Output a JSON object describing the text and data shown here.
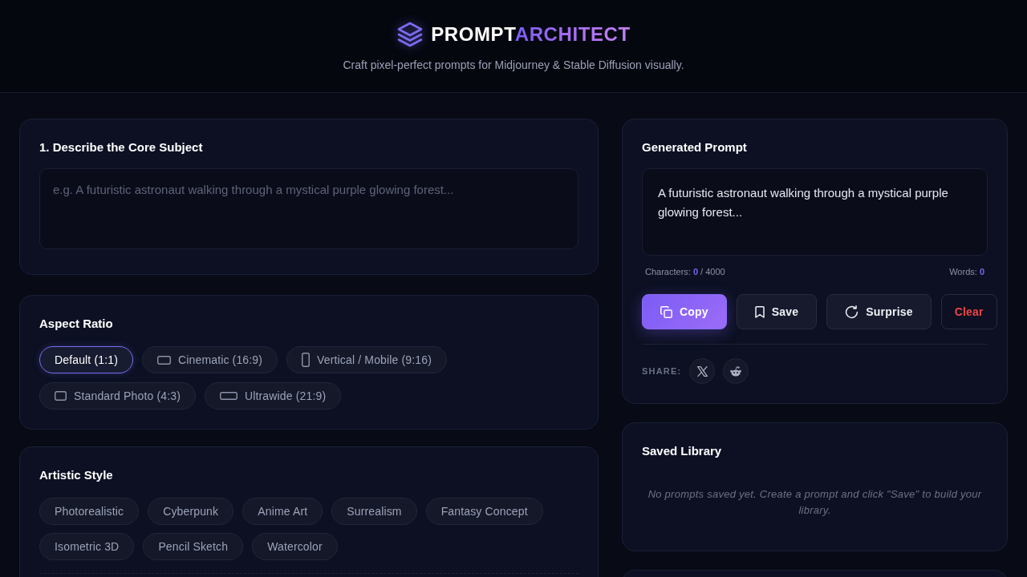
{
  "header": {
    "logo": {
      "text_main": "PROMPT",
      "text_accent": "ARCHITECT"
    },
    "tagline": "Craft pixel-perfect prompts for Midjourney & Stable Diffusion visually."
  },
  "subject": {
    "title": "1. Describe the Core Subject",
    "placeholder": "e.g. A futuristic astronaut walking through a mystical purple glowing forest..."
  },
  "aspect_ratio": {
    "title": "Aspect Ratio",
    "options": [
      {
        "label": "Default (1:1)",
        "kind": "plain",
        "selected": true
      },
      {
        "label": "Cinematic (16:9)",
        "kind": "wide",
        "selected": false
      },
      {
        "label": "Vertical / Mobile (9:16)",
        "kind": "tall",
        "selected": false
      },
      {
        "label": "Standard Photo (4:3)",
        "kind": "photo",
        "selected": false
      },
      {
        "label": "Ultrawide (21:9)",
        "kind": "ultrawide",
        "selected": false
      }
    ]
  },
  "artistic_style": {
    "title": "Artistic Style",
    "options": [
      {
        "label": "Photorealistic",
        "selected": false
      },
      {
        "label": "Cyberpunk",
        "selected": false
      },
      {
        "label": "Anime Art",
        "selected": false
      },
      {
        "label": "Surrealism",
        "selected": false
      },
      {
        "label": "Fantasy Concept",
        "selected": false
      },
      {
        "label": "Isometric 3D",
        "selected": false
      },
      {
        "label": "Pencil Sketch",
        "selected": false
      },
      {
        "label": "Watercolor",
        "selected": false
      }
    ]
  },
  "generated_prompt": {
    "title": "Generated Prompt",
    "text": "A futuristic astronaut walking through a mystical purple glowing forest...",
    "characters": {
      "label": "Characters:",
      "count": "0",
      "limit": "/ 4000"
    },
    "words": {
      "label": "Words:",
      "count": "0"
    },
    "actions": [
      {
        "label": "Copy",
        "kind": "copy"
      },
      {
        "label": "Save",
        "kind": "save"
      },
      {
        "label": "Surprise",
        "kind": "surprise"
      },
      {
        "label": "Clear",
        "kind": "clear"
      }
    ],
    "share": {
      "label": "SHARE:",
      "links": [
        {
          "kind": "x"
        },
        {
          "kind": "reddit"
        }
      ]
    }
  },
  "saved_library": {
    "title": "Saved Library",
    "empty_message": "No prompts saved yet. Create a prompt and click \"Save\" to build your library."
  }
}
